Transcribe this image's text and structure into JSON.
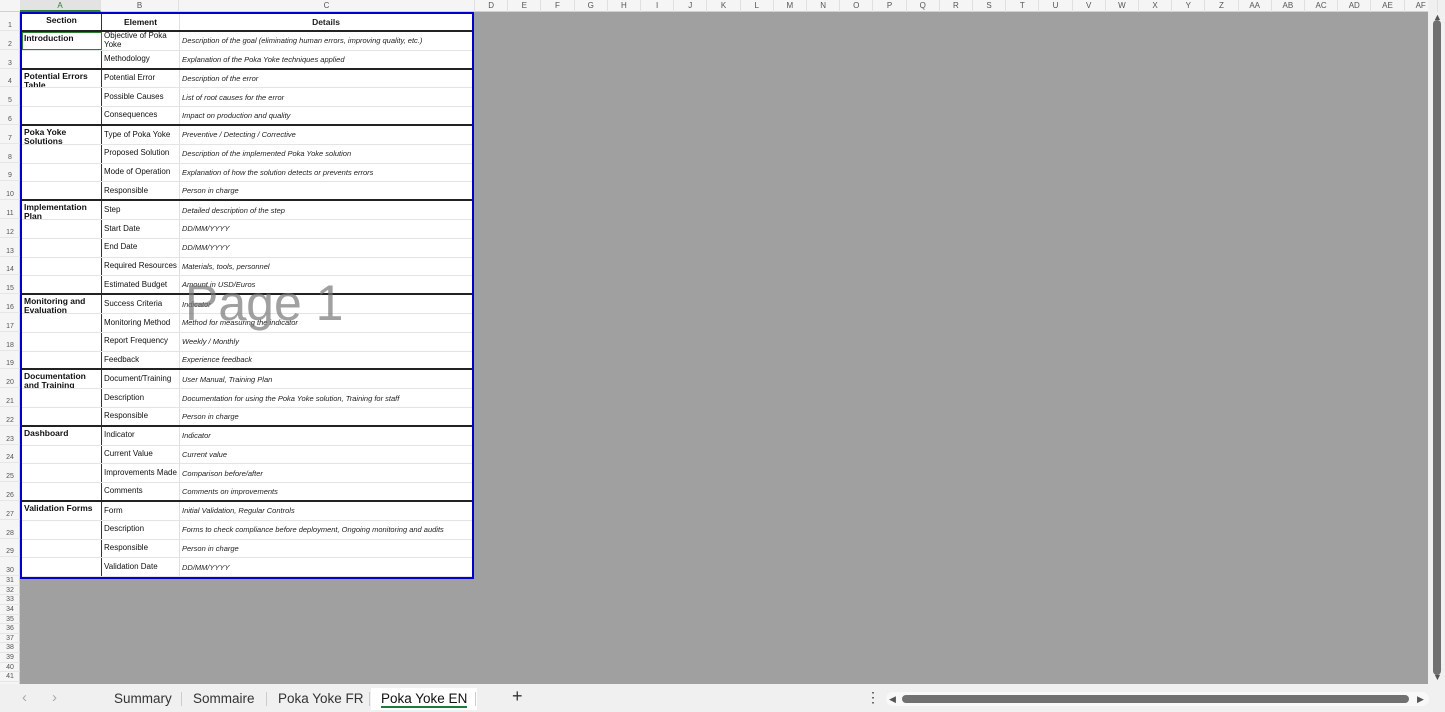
{
  "columns": [
    "A",
    "B",
    "C",
    "D",
    "E",
    "F",
    "G",
    "H",
    "I",
    "J",
    "K",
    "L",
    "M",
    "N",
    "O",
    "P",
    "Q",
    "R",
    "S",
    "T",
    "U",
    "V",
    "W",
    "X",
    "Y",
    "Z",
    "AA",
    "AB",
    "AC",
    "AD",
    "AE",
    "AF"
  ],
  "rows": [
    "1",
    "2",
    "3",
    "4",
    "5",
    "6",
    "7",
    "8",
    "9",
    "10",
    "11",
    "12",
    "13",
    "14",
    "15",
    "16",
    "17",
    "18",
    "19",
    "20",
    "21",
    "22",
    "23",
    "24",
    "25",
    "26",
    "27",
    "28",
    "29",
    "30",
    "31",
    "32",
    "33",
    "34",
    "35",
    "36",
    "37",
    "38",
    "39",
    "40",
    "41"
  ],
  "table": {
    "headers": {
      "section": "Section",
      "element": "Element",
      "details": "Details"
    },
    "rows": [
      {
        "section": "Introduction",
        "element": "Objective of Poka Yoke",
        "details": "Description of the goal (eliminating human errors, improving quality, etc.)"
      },
      {
        "section": "",
        "element": "Methodology",
        "details": "Explanation of the Poka Yoke techniques applied",
        "end": true
      },
      {
        "section": "Potential Errors Table",
        "element": "Potential Error",
        "details": "Description of the error"
      },
      {
        "section": "",
        "element": "Possible Causes",
        "details": "List of root causes for the error"
      },
      {
        "section": "",
        "element": "Consequences",
        "details": "Impact on production and quality",
        "end": true
      },
      {
        "section": "Poka Yoke Solutions",
        "element": "Type of Poka Yoke",
        "details": "Preventive / Detecting / Corrective"
      },
      {
        "section": "",
        "element": "Proposed Solution",
        "details": "Description of the implemented Poka Yoke solution"
      },
      {
        "section": "",
        "element": "Mode of Operation",
        "details": "Explanation of how the solution detects or prevents errors"
      },
      {
        "section": "",
        "element": "Responsible",
        "details": "Person in charge",
        "end": true
      },
      {
        "section": "Implementation Plan",
        "element": "Step",
        "details": "Detailed description of the step"
      },
      {
        "section": "",
        "element": "Start Date",
        "details": "DD/MM/YYYY"
      },
      {
        "section": "",
        "element": "End Date",
        "details": "DD/MM/YYYY"
      },
      {
        "section": "",
        "element": "Required Resources",
        "details": "Materials, tools, personnel"
      },
      {
        "section": "",
        "element": "Estimated Budget",
        "details": "Amount in USD/Euros",
        "end": true
      },
      {
        "section": "Monitoring and Evaluation",
        "element": "Success Criteria",
        "details": "Indicator"
      },
      {
        "section": "",
        "element": "Monitoring Method",
        "details": "Method for measuring the indicator"
      },
      {
        "section": "",
        "element": "Report Frequency",
        "details": "Weekly / Monthly"
      },
      {
        "section": "",
        "element": "Feedback",
        "details": "Experience feedback",
        "end": true
      },
      {
        "section": "Documentation and Training",
        "element": "Document/Training",
        "details": "User Manual, Training Plan"
      },
      {
        "section": "",
        "element": "Description",
        "details": "Documentation for using the Poka Yoke solution, Training for staff"
      },
      {
        "section": "",
        "element": "Responsible",
        "details": "Person in charge",
        "end": true
      },
      {
        "section": "Dashboard",
        "element": "Indicator",
        "details": "Indicator"
      },
      {
        "section": "",
        "element": "Current Value",
        "details": "Current value"
      },
      {
        "section": "",
        "element": "Improvements Made",
        "details": "Comparison before/after"
      },
      {
        "section": "",
        "element": "Comments",
        "details": "Comments on improvements",
        "end": true
      },
      {
        "section": "Validation Forms",
        "element": "Form",
        "details": "Initial Validation, Regular Controls"
      },
      {
        "section": "",
        "element": "Description",
        "details": "Forms to check compliance before deployment, Ongoing monitoring and audits"
      },
      {
        "section": "",
        "element": "Responsible",
        "details": "Person in charge"
      },
      {
        "section": "",
        "element": "Validation Date",
        "details": "DD/MM/YYYY"
      }
    ]
  },
  "watermark": "Page 1",
  "tabs": [
    {
      "label": "Summary",
      "active": false
    },
    {
      "label": "Sommaire",
      "active": false
    },
    {
      "label": "Poka Yoke FR",
      "active": false
    },
    {
      "label": "Poka Yoke EN",
      "active": true
    }
  ],
  "add_sheet_label": "+",
  "nav": {
    "prev": "‹",
    "next": "›",
    "more": "⋮"
  }
}
